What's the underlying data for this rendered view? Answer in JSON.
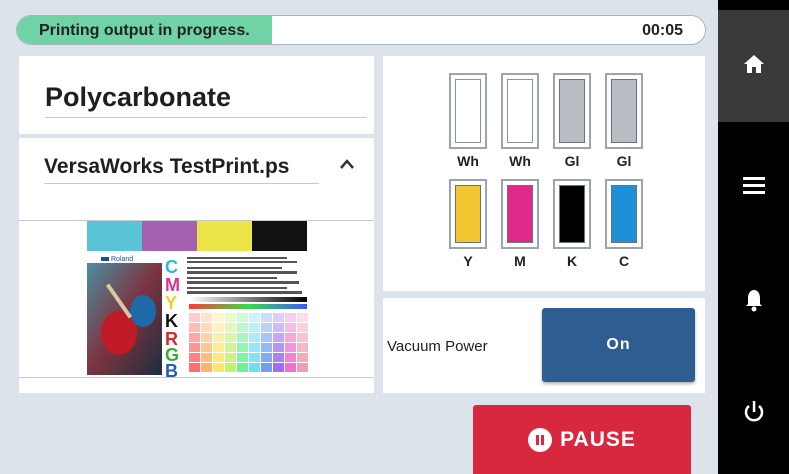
{
  "status": {
    "message": "Printing output in progress.",
    "time": "00:05",
    "progress": 0.37
  },
  "media": {
    "name": "Polycarbonate"
  },
  "job": {
    "filename": "VersaWorks TestPrint.ps"
  },
  "inks": [
    {
      "label": "Wh",
      "color": "#ffffff"
    },
    {
      "label": "Wh",
      "color": "#ffffff"
    },
    {
      "label": "Gl",
      "color": "#b8bcc3"
    },
    {
      "label": "Gl",
      "color": "#b8bcc3"
    },
    {
      "label": "Y",
      "color": "#f2c531"
    },
    {
      "label": "M",
      "color": "#e0298b"
    },
    {
      "label": "K",
      "color": "#000000"
    },
    {
      "label": "C",
      "color": "#1f8fd6"
    }
  ],
  "vacuum": {
    "label": "Vacuum Power",
    "button": "On"
  },
  "pause": {
    "label": "PAUSE"
  },
  "nav": {
    "icons": [
      "home-icon",
      "menu-icon",
      "bell-icon",
      "power-icon"
    ]
  },
  "preview": {
    "brand": "Roland",
    "letters": [
      "C",
      "M",
      "Y",
      "K",
      "R",
      "G",
      "B"
    ]
  },
  "colors": {
    "accent": "#2d5d91",
    "pause": "#d7283f",
    "progress": "#6fd3a6"
  }
}
